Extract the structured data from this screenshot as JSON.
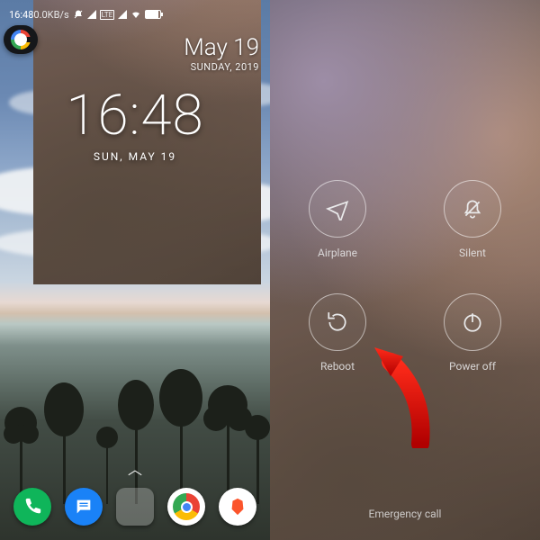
{
  "status": {
    "time": "16:48",
    "net_rate": "0.0KB/s"
  },
  "date_widget": {
    "line1": "May 19",
    "line2": "SUNDAY, 2019"
  },
  "clock": {
    "time": "16:48",
    "date": "SUN, MAY 19"
  },
  "dock": {
    "apps": [
      {
        "name": "phone",
        "color": "#0fb55a"
      },
      {
        "name": "messages",
        "color": "#1a82f7"
      },
      {
        "name": "google-folder"
      },
      {
        "name": "chrome"
      },
      {
        "name": "brave",
        "color": "#ffffff"
      }
    ]
  },
  "power_menu": {
    "options": [
      {
        "id": "airplane",
        "label": "Airplane"
      },
      {
        "id": "silent",
        "label": "Silent"
      },
      {
        "id": "reboot",
        "label": "Reboot"
      },
      {
        "id": "poweroff",
        "label": "Power off"
      }
    ],
    "emergency": "Emergency call"
  },
  "annotation": {
    "points_to": "reboot"
  }
}
